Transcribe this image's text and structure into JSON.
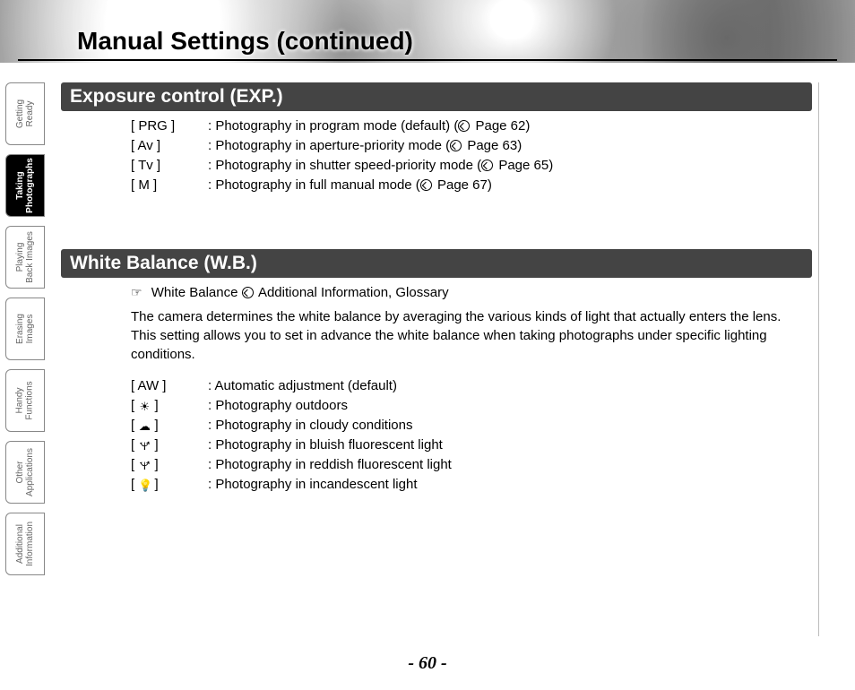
{
  "page_title": "Manual Settings (continued)",
  "page_number": "- 60 -",
  "sidebar": {
    "tabs": [
      {
        "label": "Getting\nReady",
        "active": false
      },
      {
        "label": "Taking\nPhotographs",
        "active": true
      },
      {
        "label": "Playing\nBack Images",
        "active": false
      },
      {
        "label": "Erasing\nImages",
        "active": false
      },
      {
        "label": "Handy\nFunctions",
        "active": false
      },
      {
        "label": "Other\nApplications",
        "active": false
      },
      {
        "label": "Additional\nInformation",
        "active": false
      }
    ]
  },
  "sections": {
    "exposure": {
      "heading": "Exposure control (EXP.)",
      "rows": [
        {
          "label": "[ PRG ]",
          "desc_pre": ": Photography in program mode (default) (",
          "page_ref": "Page 62",
          "desc_post": ")"
        },
        {
          "label": "[ Av ]",
          "desc_pre": ": Photography in aperture-priority mode (",
          "page_ref": "Page 63",
          "desc_post": ")"
        },
        {
          "label": "[ Tv ]",
          "desc_pre": ": Photography in shutter speed-priority mode (",
          "page_ref": "Page 65",
          "desc_post": ")"
        },
        {
          "label": "[ M ]",
          "desc_pre": ": Photography in full manual mode (",
          "page_ref": "Page 67",
          "desc_post": ")"
        }
      ]
    },
    "whitebalance": {
      "heading": "White Balance (W.B.)",
      "reference_line_pre": " White Balance ",
      "reference_line_post": " Additional Information, Glossary",
      "intro": "The camera determines the white balance by averaging the various kinds of light that actually enters the lens. This setting allows you to set in advance the white balance when taking photographs under specific lighting conditions.",
      "rows": [
        {
          "label_pre": "[ AW ]",
          "icon": "",
          "desc": ": Automatic adjustment (default)"
        },
        {
          "label_pre": "[ ",
          "icon": "☀",
          "label_post": " ]",
          "desc": ": Photography outdoors"
        },
        {
          "label_pre": "[ ",
          "icon": "☁",
          "label_post": " ]",
          "desc": ": Photography in cloudy conditions"
        },
        {
          "label_pre": "[ ",
          "icon": "🝤",
          "label_post": " ]",
          "desc": ": Photography in bluish fluorescent light"
        },
        {
          "label_pre": "[ ",
          "icon": "🝤",
          "label_post": " ]",
          "desc": ": Photography in reddish fluorescent light"
        },
        {
          "label_pre": "[ ",
          "icon": "💡",
          "label_post": " ]",
          "desc": ": Photography in incandescent light"
        }
      ]
    }
  }
}
